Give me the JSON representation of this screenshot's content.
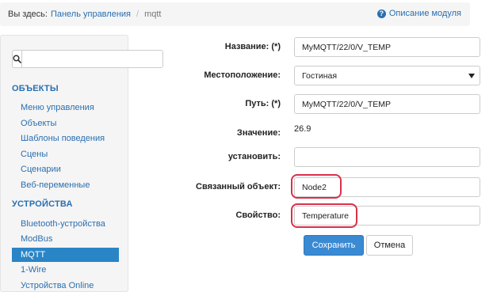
{
  "breadcrumb": {
    "here": "Вы здесь:",
    "link": "Панель управления",
    "separator": "/",
    "current": "mqtt",
    "help": "Описание модуля"
  },
  "sidebar": {
    "search_placeholder": "",
    "sections": [
      {
        "title": "ОБЪЕКТЫ",
        "items": [
          "Меню управления",
          "Объекты",
          "Шаблоны поведения",
          "Сцены",
          "Сценарии",
          "Веб-переменные"
        ]
      },
      {
        "title": "УСТРОЙСТВА",
        "items": [
          "Bluetooth-устройства",
          "ModBus",
          "MQTT",
          "1-Wire",
          "Устройства Online"
        ]
      }
    ],
    "active_item": "MQTT"
  },
  "form": {
    "name_label": "Название: (*)",
    "name_value": "MyMQTT/22/0/V_TEMP",
    "location_label": "Местоположение:",
    "location_value": "Гостиная",
    "path_label": "Путь: (*)",
    "path_value": "MyMQTT/22/0/V_TEMP",
    "value_label": "Значение:",
    "value_value": "26.9",
    "set_label": "установить:",
    "set_value": "",
    "linked_object_label": "Связанный объект:",
    "linked_object_value": "Node2",
    "property_label": "Свойство:",
    "property_value": "Temperature",
    "save_button": "Сохранить",
    "cancel_button": "Отмена"
  },
  "colors": {
    "link": "#2a6fb0",
    "active_nav": "#2a85c7",
    "primary_button": "#3a8ad3",
    "highlight": "#d9314b"
  }
}
